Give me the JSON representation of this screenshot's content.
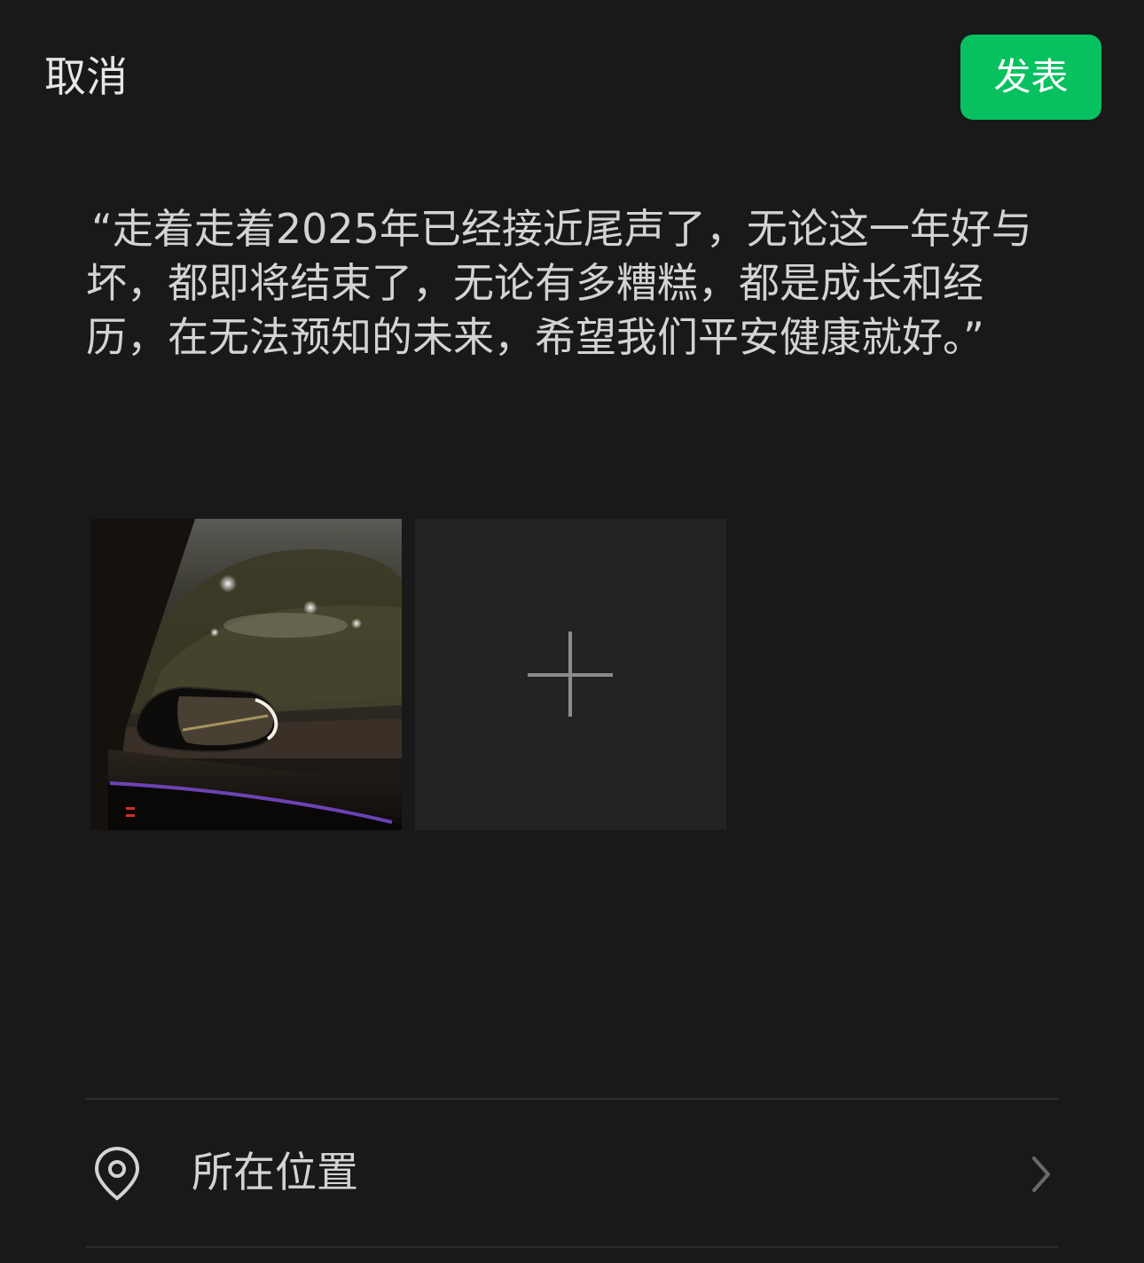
{
  "header": {
    "cancel_label": "取消",
    "publish_label": "发表",
    "publish_color": "#07c160"
  },
  "post": {
    "text": "“走着走着2025年已经接近尾声了，无论这一年好与坏，都即将结束了，无论有多糟糕，都是成长和经历，在无法预知的未来，希望我们平安健康就好。”"
  },
  "media": {
    "photo_icon": "night-car-side-mirror-photo",
    "add_icon": "plus-icon"
  },
  "location": {
    "label": "所在位置",
    "icon": "location-pin-icon",
    "chevron": "chevron-right-icon"
  }
}
